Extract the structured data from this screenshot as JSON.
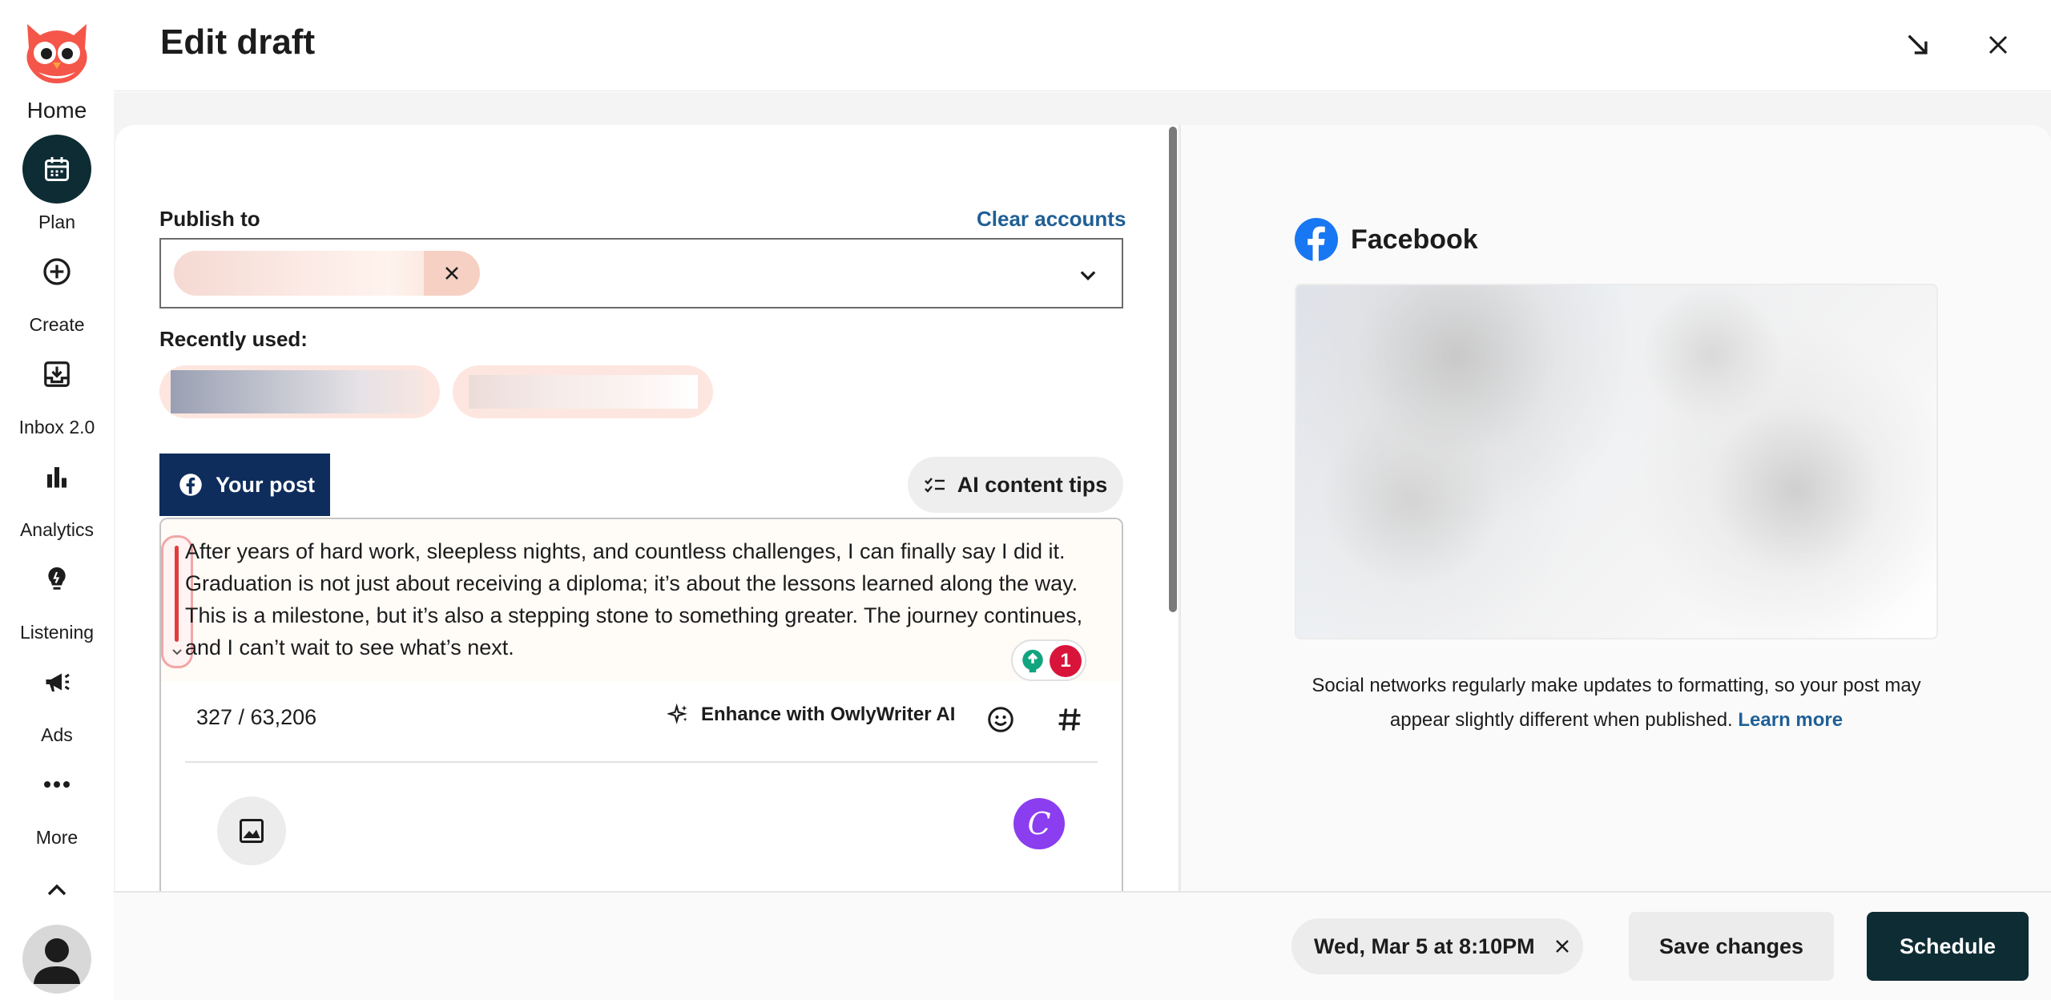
{
  "app": {
    "title": "Edit draft",
    "brand_color": "#0e2c33",
    "accent_link_color": "#1f5f95"
  },
  "sidebar": {
    "logo": "owl-logo",
    "home_label": "Home",
    "items": [
      {
        "label": "Plan",
        "icon": "calendar-icon",
        "active": true
      },
      {
        "label": "Create",
        "icon": "plus-circle-icon",
        "active": false
      },
      {
        "label": "Inbox 2.0",
        "icon": "inbox-icon",
        "active": false
      },
      {
        "label": "Analytics",
        "icon": "bar-chart-icon",
        "active": false
      },
      {
        "label": "Listening",
        "icon": "lightbulb-icon",
        "active": false
      },
      {
        "label": "Ads",
        "icon": "megaphone-icon",
        "active": false
      },
      {
        "label": "More",
        "icon": "ellipsis-icon",
        "active": false
      }
    ],
    "collapse_icon": "chevron-up-icon",
    "avatar_icon": "user-avatar-icon"
  },
  "header": {
    "minimize_icon": "arrow-diagonal-icon",
    "close_icon": "close-icon"
  },
  "compose": {
    "publish_to_label": "Publish to",
    "clear_accounts_label": "Clear accounts",
    "recently_used_label": "Recently used:",
    "your_post_tab": "Your post",
    "ai_tips_label": "AI content tips",
    "post_text": "After years of hard work, sleepless nights, and countless challenges, I can finally say I did it. Graduation is not just about receiving a diploma; it’s about the lessons learned along the way. This is a milestone, but it’s also a stepping stone to something greater. The journey continues, and I can’t wait to see what’s next.",
    "char_count": "327 / 63,206",
    "enhance_label": "Enhance with OwlyWriter AI",
    "grammar_count": "1",
    "canva_letter": "C"
  },
  "preview": {
    "network": "Facebook",
    "note_text": "Social networks regularly make updates to formatting, so your post may appear slightly different when published.",
    "learn_more": "Learn more"
  },
  "footer": {
    "schedule_date": "Wed, Mar 5 at 8:10PM",
    "save_label": "Save changes",
    "schedule_label": "Schedule"
  }
}
